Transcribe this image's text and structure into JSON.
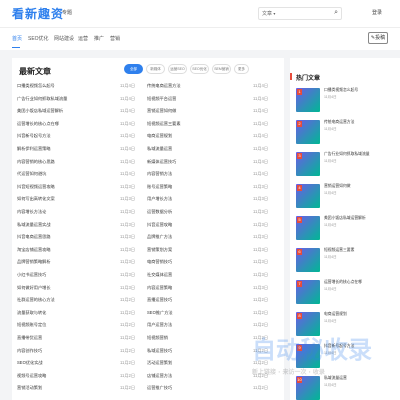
{
  "header": {
    "logo_text": "看新趣资",
    "topic_link": "专题",
    "search": {
      "selector": "文章",
      "placeholder": ""
    },
    "login": "登录"
  },
  "nav": {
    "items": [
      "首页",
      "SEO优化",
      "网站建设",
      "运营",
      "推广",
      "营销"
    ],
    "active_index": 0,
    "contribute_button": "投稿"
  },
  "main": {
    "title": "最新文章",
    "filters": [
      "全部",
      "新媒体",
      "运营SEO",
      "SEO优化",
      "SEM营销",
      "更多"
    ],
    "active_filter_index": 0,
    "left": [
      {
        "title": "口播类视频怎么起号",
        "date": "11月4日"
      },
      {
        "title": "广告行业如何抓取私域流量",
        "date": "11月4日"
      },
      {
        "title": "美团小饭店私域运营解析",
        "date": "11月4日"
      },
      {
        "title": "运营增长的核心点在哪",
        "date": "11月4日"
      },
      {
        "title": "抖音新号起号方法",
        "date": "11月4日"
      },
      {
        "title": "解析伊利运营策略",
        "date": "11月4日"
      },
      {
        "title": "内容营销的核心思路",
        "date": "11月4日"
      },
      {
        "title": "代运营如何避坑",
        "date": "11月4日"
      },
      {
        "title": "抖音短视频运营攻略",
        "date": "11月3日"
      },
      {
        "title": "如何写出高转化文案",
        "date": "11月3日"
      },
      {
        "title": "内容增长方法论",
        "date": "11月3日"
      },
      {
        "title": "私域流量运营实战",
        "date": "11月3日"
      },
      {
        "title": "抖音电商运营思路",
        "date": "11月3日"
      },
      {
        "title": "淘宝店铺运营攻略",
        "date": "11月3日"
      },
      {
        "title": "品牌营销策略解析",
        "date": "11月3日"
      },
      {
        "title": "小红书运营技巧",
        "date": "11月3日"
      },
      {
        "title": "如何做好用户增长",
        "date": "11月3日"
      },
      {
        "title": "社群运营的核心方法",
        "date": "11月2日"
      },
      {
        "title": "流量获取与转化",
        "date": "11月2日"
      },
      {
        "title": "短视频账号定位",
        "date": "11月2日"
      },
      {
        "title": "直播带货运营",
        "date": "11月2日"
      },
      {
        "title": "内容创作技巧",
        "date": "11月2日"
      },
      {
        "title": "SEO优化实战",
        "date": "11月2日"
      },
      {
        "title": "视频号运营攻略",
        "date": "11月2日"
      },
      {
        "title": "营销活动策划",
        "date": "11月2日"
      }
    ],
    "right": [
      {
        "title": "传统电商运营方法",
        "date": "11月4日"
      },
      {
        "title": "短视频平台运营",
        "date": "11月4日"
      },
      {
        "title": "营销运营如何做",
        "date": "11月4日"
      },
      {
        "title": "短视频运营三要素",
        "date": "11月4日"
      },
      {
        "title": "电商运营规划",
        "date": "11月4日"
      },
      {
        "title": "私域流量运营",
        "date": "11月4日"
      },
      {
        "title": "新媒体运营技巧",
        "date": "11月4日"
      },
      {
        "title": "内容营销方法",
        "date": "11月4日"
      },
      {
        "title": "账号运营策略",
        "date": "11月3日"
      },
      {
        "title": "用户增长方法",
        "date": "11月3日"
      },
      {
        "title": "运营数据分析",
        "date": "11月3日"
      },
      {
        "title": "抖音运营攻略",
        "date": "11月3日"
      },
      {
        "title": "品牌推广方法",
        "date": "11月3日"
      },
      {
        "title": "营销策划方案",
        "date": "11月3日"
      },
      {
        "title": "电商营销技巧",
        "date": "11月3日"
      },
      {
        "title": "社交媒体运营",
        "date": "11月3日"
      },
      {
        "title": "内容运营策略",
        "date": "11月3日"
      },
      {
        "title": "直播运营技巧",
        "date": "11月2日"
      },
      {
        "title": "SEO推广方法",
        "date": "11月2日"
      },
      {
        "title": "用户运营方法",
        "date": "11月2日"
      },
      {
        "title": "短视频营销",
        "date": "11月2日"
      },
      {
        "title": "私域运营技巧",
        "date": "11月2日"
      },
      {
        "title": "活动运营策划",
        "date": "11月2日"
      },
      {
        "title": "店铺运营方法",
        "date": "11月2日"
      },
      {
        "title": "运营推广技巧",
        "date": "11月2日"
      }
    ]
  },
  "sidebar": {
    "title": "热门文章",
    "items": [
      {
        "num": "1",
        "title": "口播类视频怎么起号",
        "date": "11月4日"
      },
      {
        "num": "2",
        "title": "传统电商运营方法",
        "date": "11月4日"
      },
      {
        "num": "3",
        "title": "广告行业如何抓取私域流量",
        "date": "11月4日"
      },
      {
        "num": "4",
        "title": "营销运营如何做",
        "date": "11月4日"
      },
      {
        "num": "5",
        "title": "美团小饭店私域运营解析",
        "date": "11月4日"
      },
      {
        "num": "6",
        "title": "短视频运营三要素",
        "date": "11月4日"
      },
      {
        "num": "7",
        "title": "运营增长的核心点在哪",
        "date": "11月4日"
      },
      {
        "num": "8",
        "title": "电商运营规划",
        "date": "11月4日"
      },
      {
        "num": "9",
        "title": "抖音新号起号方法",
        "date": "11月4日"
      },
      {
        "num": "10",
        "title": "私域流量运营",
        "date": "11月4日"
      }
    ]
  },
  "watermark": {
    "main": "自动秘收录",
    "sub": "新上链接 · 来访一次 · 收录"
  },
  "colors": {
    "accent": "#2f80ed",
    "hot": "#e74c3c"
  }
}
